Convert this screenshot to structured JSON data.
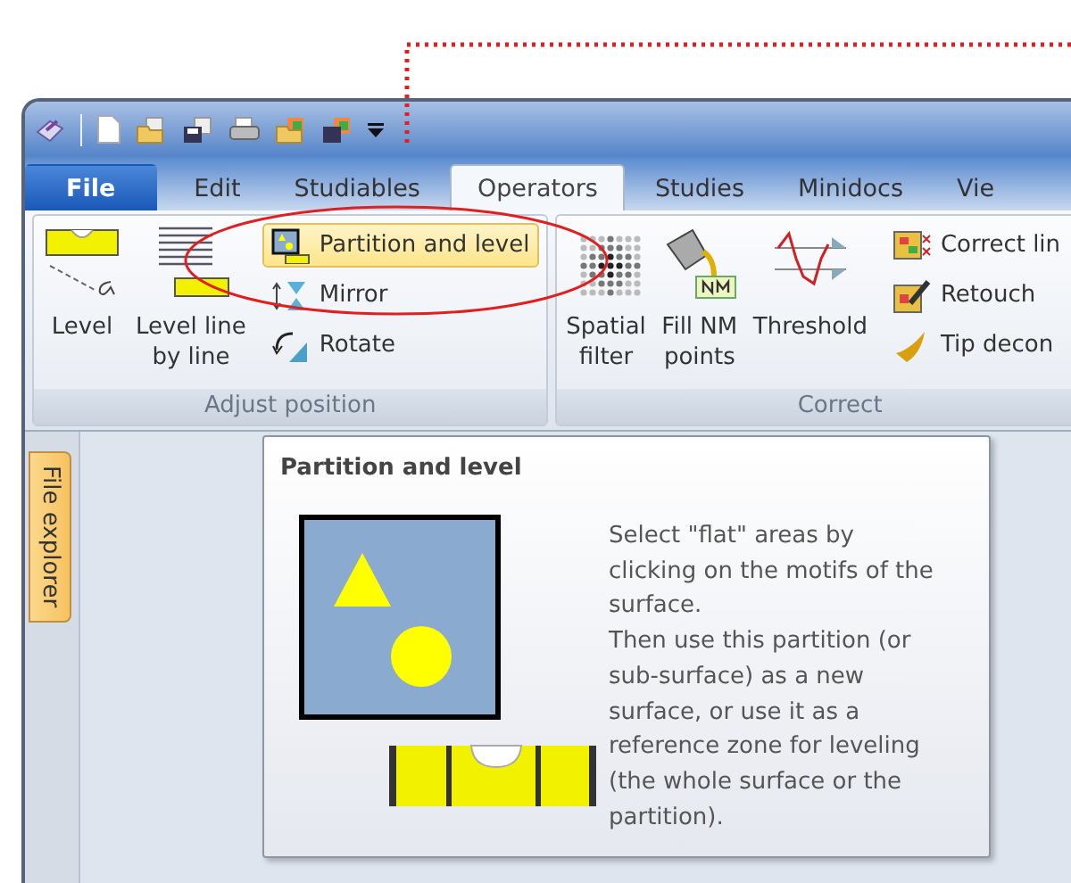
{
  "tabs": [
    {
      "label": "File",
      "selected": false,
      "kind": "file"
    },
    {
      "label": "Edit",
      "selected": false,
      "kind": "tab"
    },
    {
      "label": "Studiables",
      "selected": false,
      "kind": "tab"
    },
    {
      "label": "Operators",
      "selected": true,
      "kind": "tab"
    },
    {
      "label": "Studies",
      "selected": false,
      "kind": "tab"
    },
    {
      "label": "Minidocs",
      "selected": false,
      "kind": "tab"
    },
    {
      "label": "Vie",
      "selected": false,
      "kind": "tab"
    }
  ],
  "ribbon": {
    "groups": [
      {
        "label": "Adjust position",
        "large_buttons": [
          {
            "lines": [
              "Level"
            ]
          },
          {
            "lines": [
              "Level line",
              "by line"
            ]
          }
        ],
        "small_buttons": [
          {
            "label": "Partition and level",
            "hovered": true
          },
          {
            "label": "Mirror",
            "hovered": false
          },
          {
            "label": "Rotate",
            "hovered": false
          }
        ]
      },
      {
        "label": "Correct",
        "large_buttons": [
          {
            "lines": [
              "Spatial",
              "filter"
            ]
          },
          {
            "lines": [
              "Fill NM",
              "points"
            ]
          },
          {
            "lines": [
              "Threshold"
            ]
          }
        ],
        "small_buttons": [
          {
            "label": "Correct lin",
            "hovered": false
          },
          {
            "label": "Retouch",
            "hovered": false
          },
          {
            "label": "Tip decon",
            "hovered": false
          }
        ]
      }
    ]
  },
  "side_tab": {
    "label": "File explorer"
  },
  "tooltip": {
    "title": "Partition and level",
    "description": [
      "Select \"flat\" areas by clicking on the motifs of the surface.",
      "Then use this partition (or sub-surface) as a new surface, or use it as a reference zone for leveling (the whole surface or the partition)."
    ]
  }
}
